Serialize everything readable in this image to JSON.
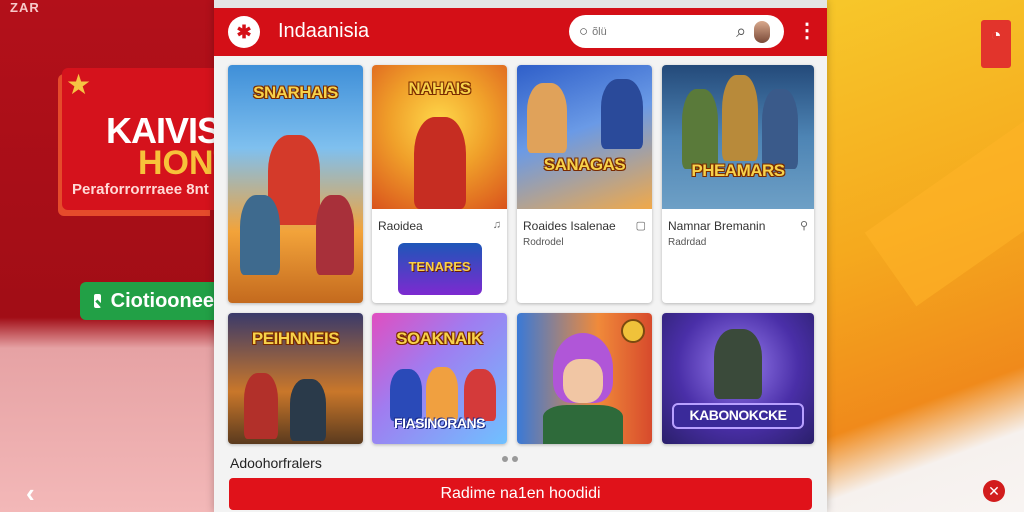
{
  "left_panel": {
    "top_text": "ZАR",
    "banner": {
      "line1": "KAIVISI",
      "line2": "HONTI",
      "line3": "Peraforrorrraee 8nt"
    },
    "button_label": "Ciotioonee",
    "back_icon": "chevron-left-icon"
  },
  "header": {
    "title": "Indaanisia",
    "search": {
      "placeholder": "õlü",
      "search_icon": "search-icon"
    },
    "menu_icon": "kebab-menu-icon"
  },
  "games": [
    {
      "title": "",
      "subtitle": "",
      "art_logo": "SNARHAIS",
      "colors": [
        "#3f8fd8",
        "#f2a33a"
      ]
    },
    {
      "title": "Raoidea",
      "subtitle": "",
      "art_logo": "NAHAIS",
      "badge_logo": "TENARES",
      "colors": [
        "#f6c22f",
        "#e46b1e"
      ]
    },
    {
      "title": "Roaides Isalenae",
      "subtitle": "Rodrodel",
      "art_logo": "SANAGAS",
      "colors": [
        "#2f5fc9",
        "#f0a94a"
      ]
    },
    {
      "title": "Namnar Bremanin",
      "subtitle": "Radrdad",
      "art_logo": "PHEAMARS",
      "colors": [
        "#244a7a",
        "#6ea0c6"
      ]
    },
    {
      "title": "",
      "subtitle": "",
      "art_logo": "PEIHNNEIS",
      "colors": [
        "#3a3a6a",
        "#f2a33a"
      ]
    },
    {
      "title": "",
      "subtitle": "",
      "art_logo": "SOAKNAIK",
      "bottom_logo": "FIASINORANS",
      "colors": [
        "#e04ec0",
        "#6fc1ff"
      ]
    },
    {
      "title": "",
      "subtitle": "",
      "art_logo": "",
      "colors": [
        "#3a79d6",
        "#d74a2c"
      ]
    },
    {
      "title": "",
      "subtitle": "",
      "art_logo": "",
      "bottom_logo": "KABONOKCKE",
      "colors": [
        "#3a2f8f",
        "#7a5fd6"
      ]
    }
  ],
  "footer": {
    "label": "Adoohorfralers",
    "cta": "Radime na1en hoodidi"
  },
  "accent_color": "#d40f17"
}
